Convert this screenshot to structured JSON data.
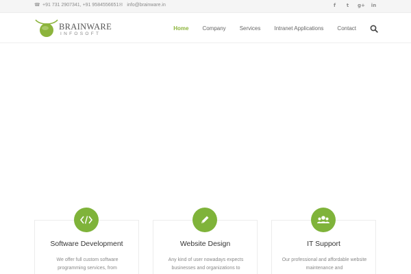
{
  "topbar": {
    "phone": "+91 731 2907341, +91 9584556651",
    "email": "info@brainware.in",
    "social": [
      "facebook-icon",
      "twitter-icon",
      "google-plus-icon",
      "linkedin-icon"
    ]
  },
  "brand": {
    "name": "BRAINWARE",
    "sub": "INFOSOFT"
  },
  "nav": {
    "items": [
      {
        "label": "Home",
        "active": true
      },
      {
        "label": "Company"
      },
      {
        "label": "Services"
      },
      {
        "label": "Intranet Applications"
      },
      {
        "label": "Contact"
      }
    ]
  },
  "colors": {
    "accent": "#7fb33a",
    "active_nav": "#8cb43c"
  },
  "services": [
    {
      "icon": "code-icon",
      "title": "Software Development",
      "desc": "We offer full custom software programming services, from"
    },
    {
      "icon": "pencil-icon",
      "title": "Website Design",
      "desc": "Any kind of user nowadays expects businesses and organizations to"
    },
    {
      "icon": "users-icon",
      "title": "IT Support",
      "desc": "Our professional and affordable website maintenance and"
    }
  ]
}
